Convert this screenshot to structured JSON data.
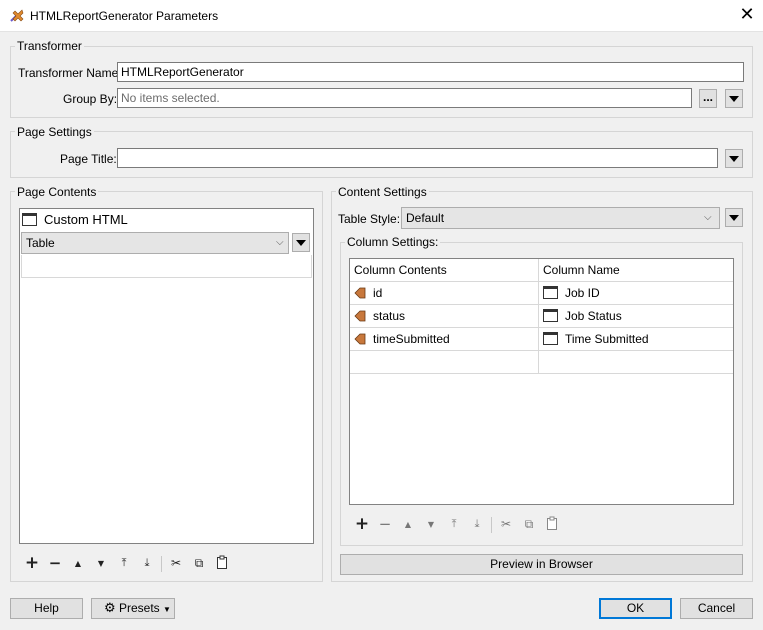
{
  "window": {
    "title": "HTMLReportGenerator Parameters",
    "close_glyph": "✕",
    "icon": "transformer-icon"
  },
  "transformer": {
    "legend": "Transformer",
    "name_label": "Transformer Name:",
    "name_value": "HTMLReportGenerator",
    "group_by_label": "Group By:",
    "group_by_value": "No items selected.",
    "ellipsis": "..."
  },
  "page_settings": {
    "legend": "Page Settings",
    "page_title_label": "Page Title:",
    "page_title_value": ""
  },
  "page_contents": {
    "legend": "Page Contents",
    "items": [
      {
        "label": "Custom HTML",
        "icon": "window-icon"
      }
    ],
    "selected_type": "Table",
    "toolbar": [
      "+",
      "−",
      "▲",
      "▼",
      "⤒",
      "⤓",
      "✂",
      "⧉",
      "📋"
    ]
  },
  "content_settings": {
    "legend": "Content Settings",
    "table_style_label": "Table Style:",
    "table_style_value": "Default",
    "column_settings_label": "Column Settings:",
    "columns": [
      "Column Contents",
      "Column Name"
    ],
    "rows": [
      {
        "content": "id",
        "name": "Job ID"
      },
      {
        "content": "status",
        "name": "Job Status"
      },
      {
        "content": "timeSubmitted",
        "name": "Time Submitted"
      }
    ],
    "preview_button": "Preview in Browser"
  },
  "footer": {
    "help": "Help",
    "presets": "Presets",
    "ok": "OK",
    "cancel": "Cancel"
  },
  "colors": {
    "accent": "#0078d7",
    "attribute_icon": "#c8783c"
  }
}
